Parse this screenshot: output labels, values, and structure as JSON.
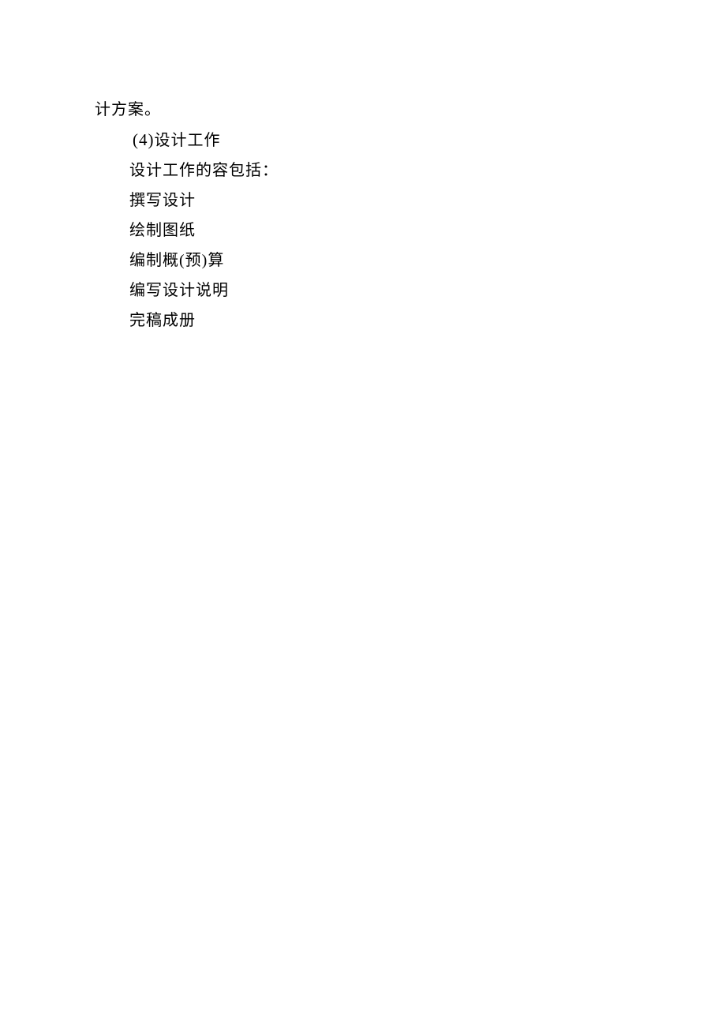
{
  "content": {
    "line1": "计方案。",
    "heading_number": "(4)",
    "heading_text": "设计工作",
    "line3": "设计工作的容包括：",
    "line4": "撰写设计",
    "line5": "绘制图纸",
    "line6": "编制概(预)算",
    "line7": "编写设计说明",
    "line8": "完稿成册"
  }
}
